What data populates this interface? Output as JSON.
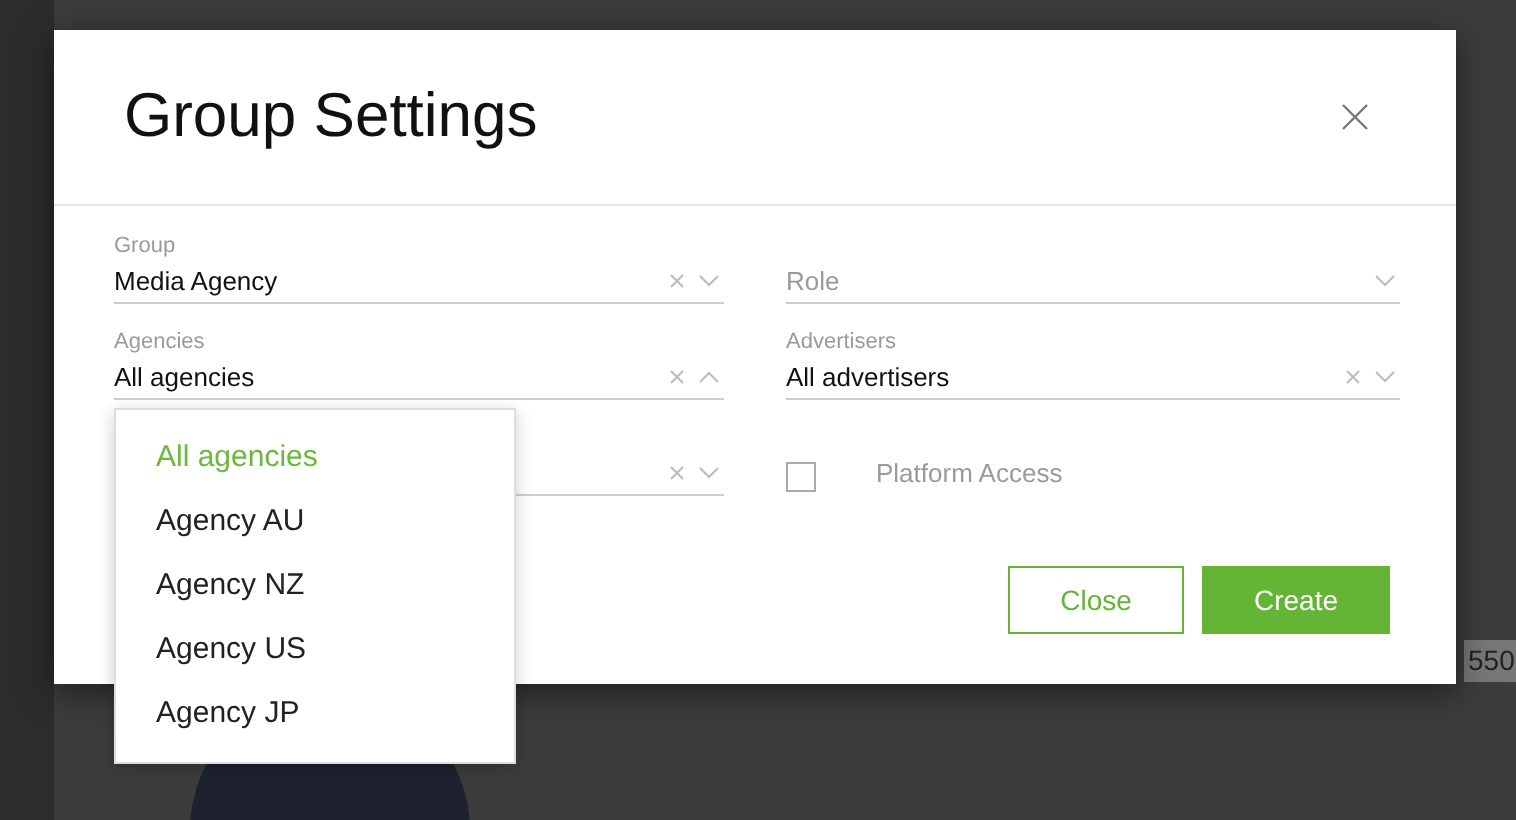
{
  "background": {
    "number_fragment": "550"
  },
  "dialog": {
    "title": "Group Settings",
    "items": [
      {
        "kind": "select",
        "label": "Group",
        "value": "Media Agency",
        "clearable": true,
        "expanded": false
      },
      {
        "kind": "select",
        "placeholder": "Role",
        "clearable": false,
        "expanded": false
      },
      {
        "kind": "select",
        "label": "Agencies",
        "value": "All agencies",
        "clearable": true,
        "expanded": true,
        "options": [
          {
            "label": "All agencies",
            "selected": true
          },
          {
            "label": "Agency AU",
            "selected": false
          },
          {
            "label": "Agency NZ",
            "selected": false
          },
          {
            "label": "Agency US",
            "selected": false
          },
          {
            "label": "Agency JP",
            "selected": false
          }
        ]
      },
      {
        "kind": "select",
        "label": "Advertisers",
        "value": "All advertisers",
        "clearable": true,
        "expanded": false
      },
      {
        "kind": "select",
        "clearable": true,
        "expanded": false
      },
      {
        "kind": "checkbox",
        "label": "Platform Access",
        "checked": false
      }
    ],
    "buttons": [
      {
        "label": "Close",
        "kind": "outline"
      },
      {
        "label": "Create",
        "kind": "primary"
      }
    ]
  }
}
